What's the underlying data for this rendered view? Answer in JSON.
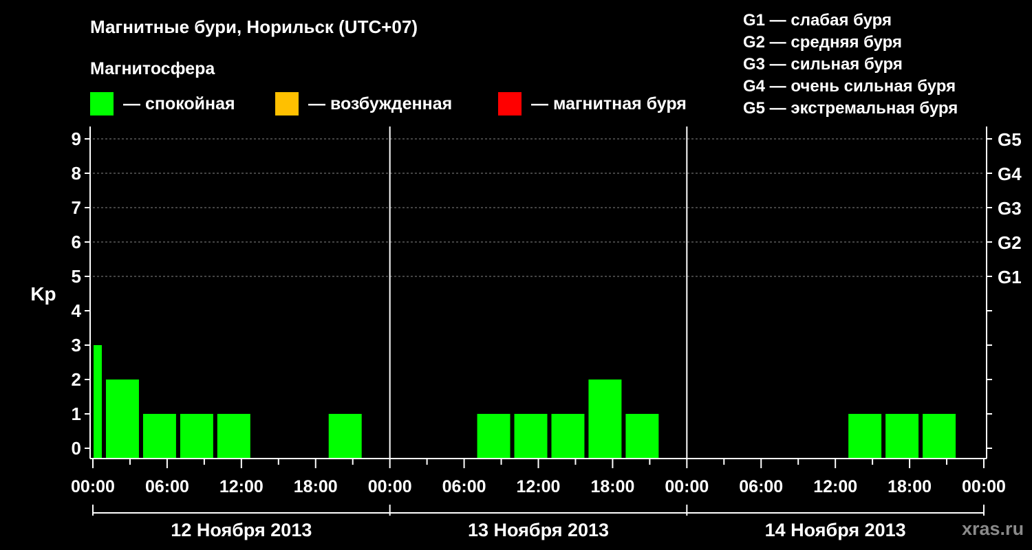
{
  "header": {
    "title": "Магнитные бури, Норильск (UTC+07)",
    "subtitle": "Магнитосфера"
  },
  "legend": [
    {
      "label": "— спокойная",
      "color": "#00ff00"
    },
    {
      "label": "— возбужденная",
      "color": "#ffc000"
    },
    {
      "label": "— магнитная буря",
      "color": "#ff0000"
    }
  ],
  "g_scale": [
    "G1 — слабая буря",
    "G2 — средняя буря",
    "G3 — сильная буря",
    "G4 — очень сильная буря",
    "G5 — экстремальная буря"
  ],
  "watermark": "xras.ru",
  "chart_data": {
    "type": "bar",
    "ylabel": "Kp",
    "ylim": [
      0,
      9
    ],
    "y_ticks": [
      0,
      1,
      2,
      3,
      4,
      5,
      6,
      7,
      8,
      9
    ],
    "right_ticks": [
      {
        "kp": 5,
        "label": "G1"
      },
      {
        "kp": 6,
        "label": "G2"
      },
      {
        "kp": 7,
        "label": "G3"
      },
      {
        "kp": 8,
        "label": "G4"
      },
      {
        "kp": 9,
        "label": "G5"
      }
    ],
    "x_ticks": [
      "00:00",
      "06:00",
      "12:00",
      "18:00",
      "00:00",
      "06:00",
      "12:00",
      "18:00",
      "00:00",
      "06:00",
      "12:00",
      "18:00",
      "00:00"
    ],
    "days": [
      "12 Ноября 2013",
      "13 Ноября 2013",
      "14 Ноября 2013"
    ],
    "grid": "dashed horizontal at Kp 5–9",
    "bar_color": "#00ff00",
    "bars": [
      {
        "start_hour": 0,
        "end_hour": 1,
        "kp": 3
      },
      {
        "start_hour": 1,
        "end_hour": 4,
        "kp": 2
      },
      {
        "start_hour": 4,
        "end_hour": 7,
        "kp": 1
      },
      {
        "start_hour": 7,
        "end_hour": 10,
        "kp": 1
      },
      {
        "start_hour": 10,
        "end_hour": 13,
        "kp": 1
      },
      {
        "start_hour": 13,
        "end_hour": 16,
        "kp": 0
      },
      {
        "start_hour": 16,
        "end_hour": 19,
        "kp": 0
      },
      {
        "start_hour": 19,
        "end_hour": 22,
        "kp": 1
      },
      {
        "start_hour": 22,
        "end_hour": 25,
        "kp": 0
      },
      {
        "start_hour": 25,
        "end_hour": 28,
        "kp": 0
      },
      {
        "start_hour": 28,
        "end_hour": 31,
        "kp": 0
      },
      {
        "start_hour": 31,
        "end_hour": 34,
        "kp": 1
      },
      {
        "start_hour": 34,
        "end_hour": 37,
        "kp": 1
      },
      {
        "start_hour": 37,
        "end_hour": 40,
        "kp": 1
      },
      {
        "start_hour": 40,
        "end_hour": 43,
        "kp": 2
      },
      {
        "start_hour": 43,
        "end_hour": 46,
        "kp": 1
      },
      {
        "start_hour": 46,
        "end_hour": 49,
        "kp": 0
      },
      {
        "start_hour": 49,
        "end_hour": 52,
        "kp": 0
      },
      {
        "start_hour": 52,
        "end_hour": 55,
        "kp": 0
      },
      {
        "start_hour": 55,
        "end_hour": 58,
        "kp": 0
      },
      {
        "start_hour": 58,
        "end_hour": 61,
        "kp": 0
      },
      {
        "start_hour": 61,
        "end_hour": 64,
        "kp": 1
      },
      {
        "start_hour": 64,
        "end_hour": 67,
        "kp": 1
      },
      {
        "start_hour": 67,
        "end_hour": 70,
        "kp": 1
      }
    ]
  }
}
